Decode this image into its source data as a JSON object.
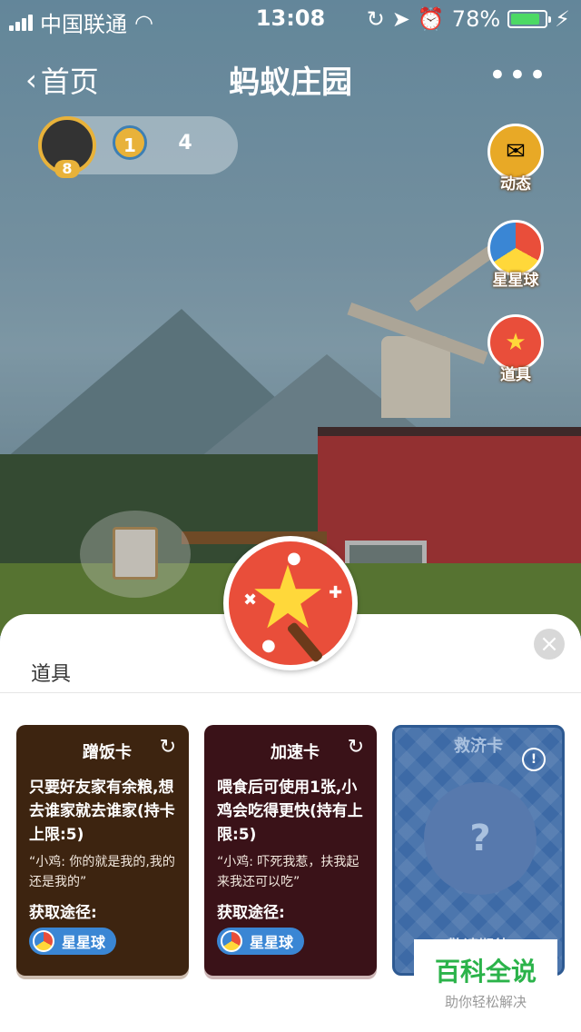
{
  "status_bar": {
    "carrier": "中国联通",
    "time": "13:08",
    "battery": "78%",
    "battery_level": 0.78
  },
  "navbar": {
    "back_label": "首页",
    "title": "蚂蚁庄园",
    "more": "•••"
  },
  "user": {
    "level": "8",
    "medal": "1",
    "hearts": "4"
  },
  "side_buttons": [
    {
      "label": "动态",
      "icon": "mailbox-icon"
    },
    {
      "label": "星星球",
      "icon": "star-ball-icon"
    },
    {
      "label": "道具",
      "icon": "magic-wand-icon"
    }
  ],
  "sheet": {
    "title": "道具",
    "close": "×",
    "cards": [
      {
        "title": "蹭饭卡",
        "desc": "只要好友家有余粮,想去谁家就去谁家(持卡上限:5)",
        "quote": "“小鸡: 你的就是我的,我的还是我的”",
        "source_label": "获取途径:",
        "source": "星星球",
        "color": "#3d2410"
      },
      {
        "title": "加速卡",
        "desc": "喂食后可使用1张,小鸡会吃得更快(持有上限:5)",
        "quote": "“小鸡: 吓死我惹，扶我起来我还可以吃”",
        "source_label": "获取途径:",
        "source": "星星球",
        "color": "#3a1218"
      },
      {
        "title": "救济卡",
        "question": "?",
        "bottom": "敬请期待",
        "color": "#3d6aa6"
      }
    ]
  },
  "watermark": {
    "title": "百科全说",
    "subtitle": "助你轻松解决"
  }
}
